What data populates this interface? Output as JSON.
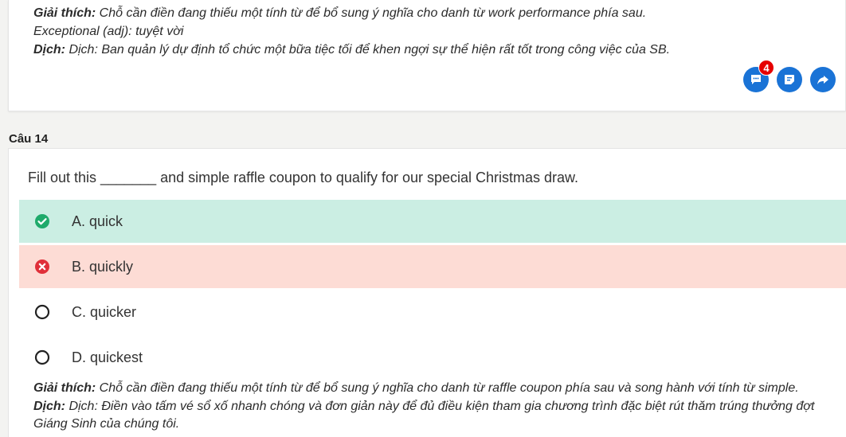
{
  "prev": {
    "explain_label": "Giải thích:",
    "explain_text": " Chỗ cần điền đang thiếu một tính từ để bổ sung ý nghĩa cho danh từ work performance phía sau.",
    "vocab_line": "Exceptional (adj): tuyệt vời",
    "translate_label": "Dịch:",
    "translate_text": " Dịch: Ban quản lý dự định tổ chức một bữa tiệc tối để khen ngợi sự thể hiện rất tốt trong công việc của SB.",
    "comment_count": "4"
  },
  "question": {
    "label": "Câu 14",
    "text": "Fill out this _______ and simple raffle coupon to qualify for our special Christmas draw.",
    "options": [
      {
        "label": "A. quick",
        "state": "correct"
      },
      {
        "label": "B. quickly",
        "state": "wrong"
      },
      {
        "label": "C. quicker",
        "state": "none"
      },
      {
        "label": "D. quickest",
        "state": "none"
      }
    ],
    "explain_label": "Giải thích:",
    "explain_text": " Chỗ cần điền đang thiếu một tính từ để bổ sung ý nghĩa cho danh từ raffle coupon phía sau và song hành với tính từ simple.",
    "translate_label": "Dịch:",
    "translate_text": " Dịch: Điền vào tấm vé sổ xố nhanh chóng và đơn giản này để đủ điều kiện tham gia chương trình đặc biệt rút thăm trúng thưởng đợt Giáng Sinh của chúng tôi."
  },
  "colors": {
    "accent": "#1a73d6",
    "correct_bg": "#cbeee3",
    "wrong_bg": "#fddcd5",
    "correct_icon": "#1faa6b",
    "wrong_icon": "#e0303a"
  }
}
